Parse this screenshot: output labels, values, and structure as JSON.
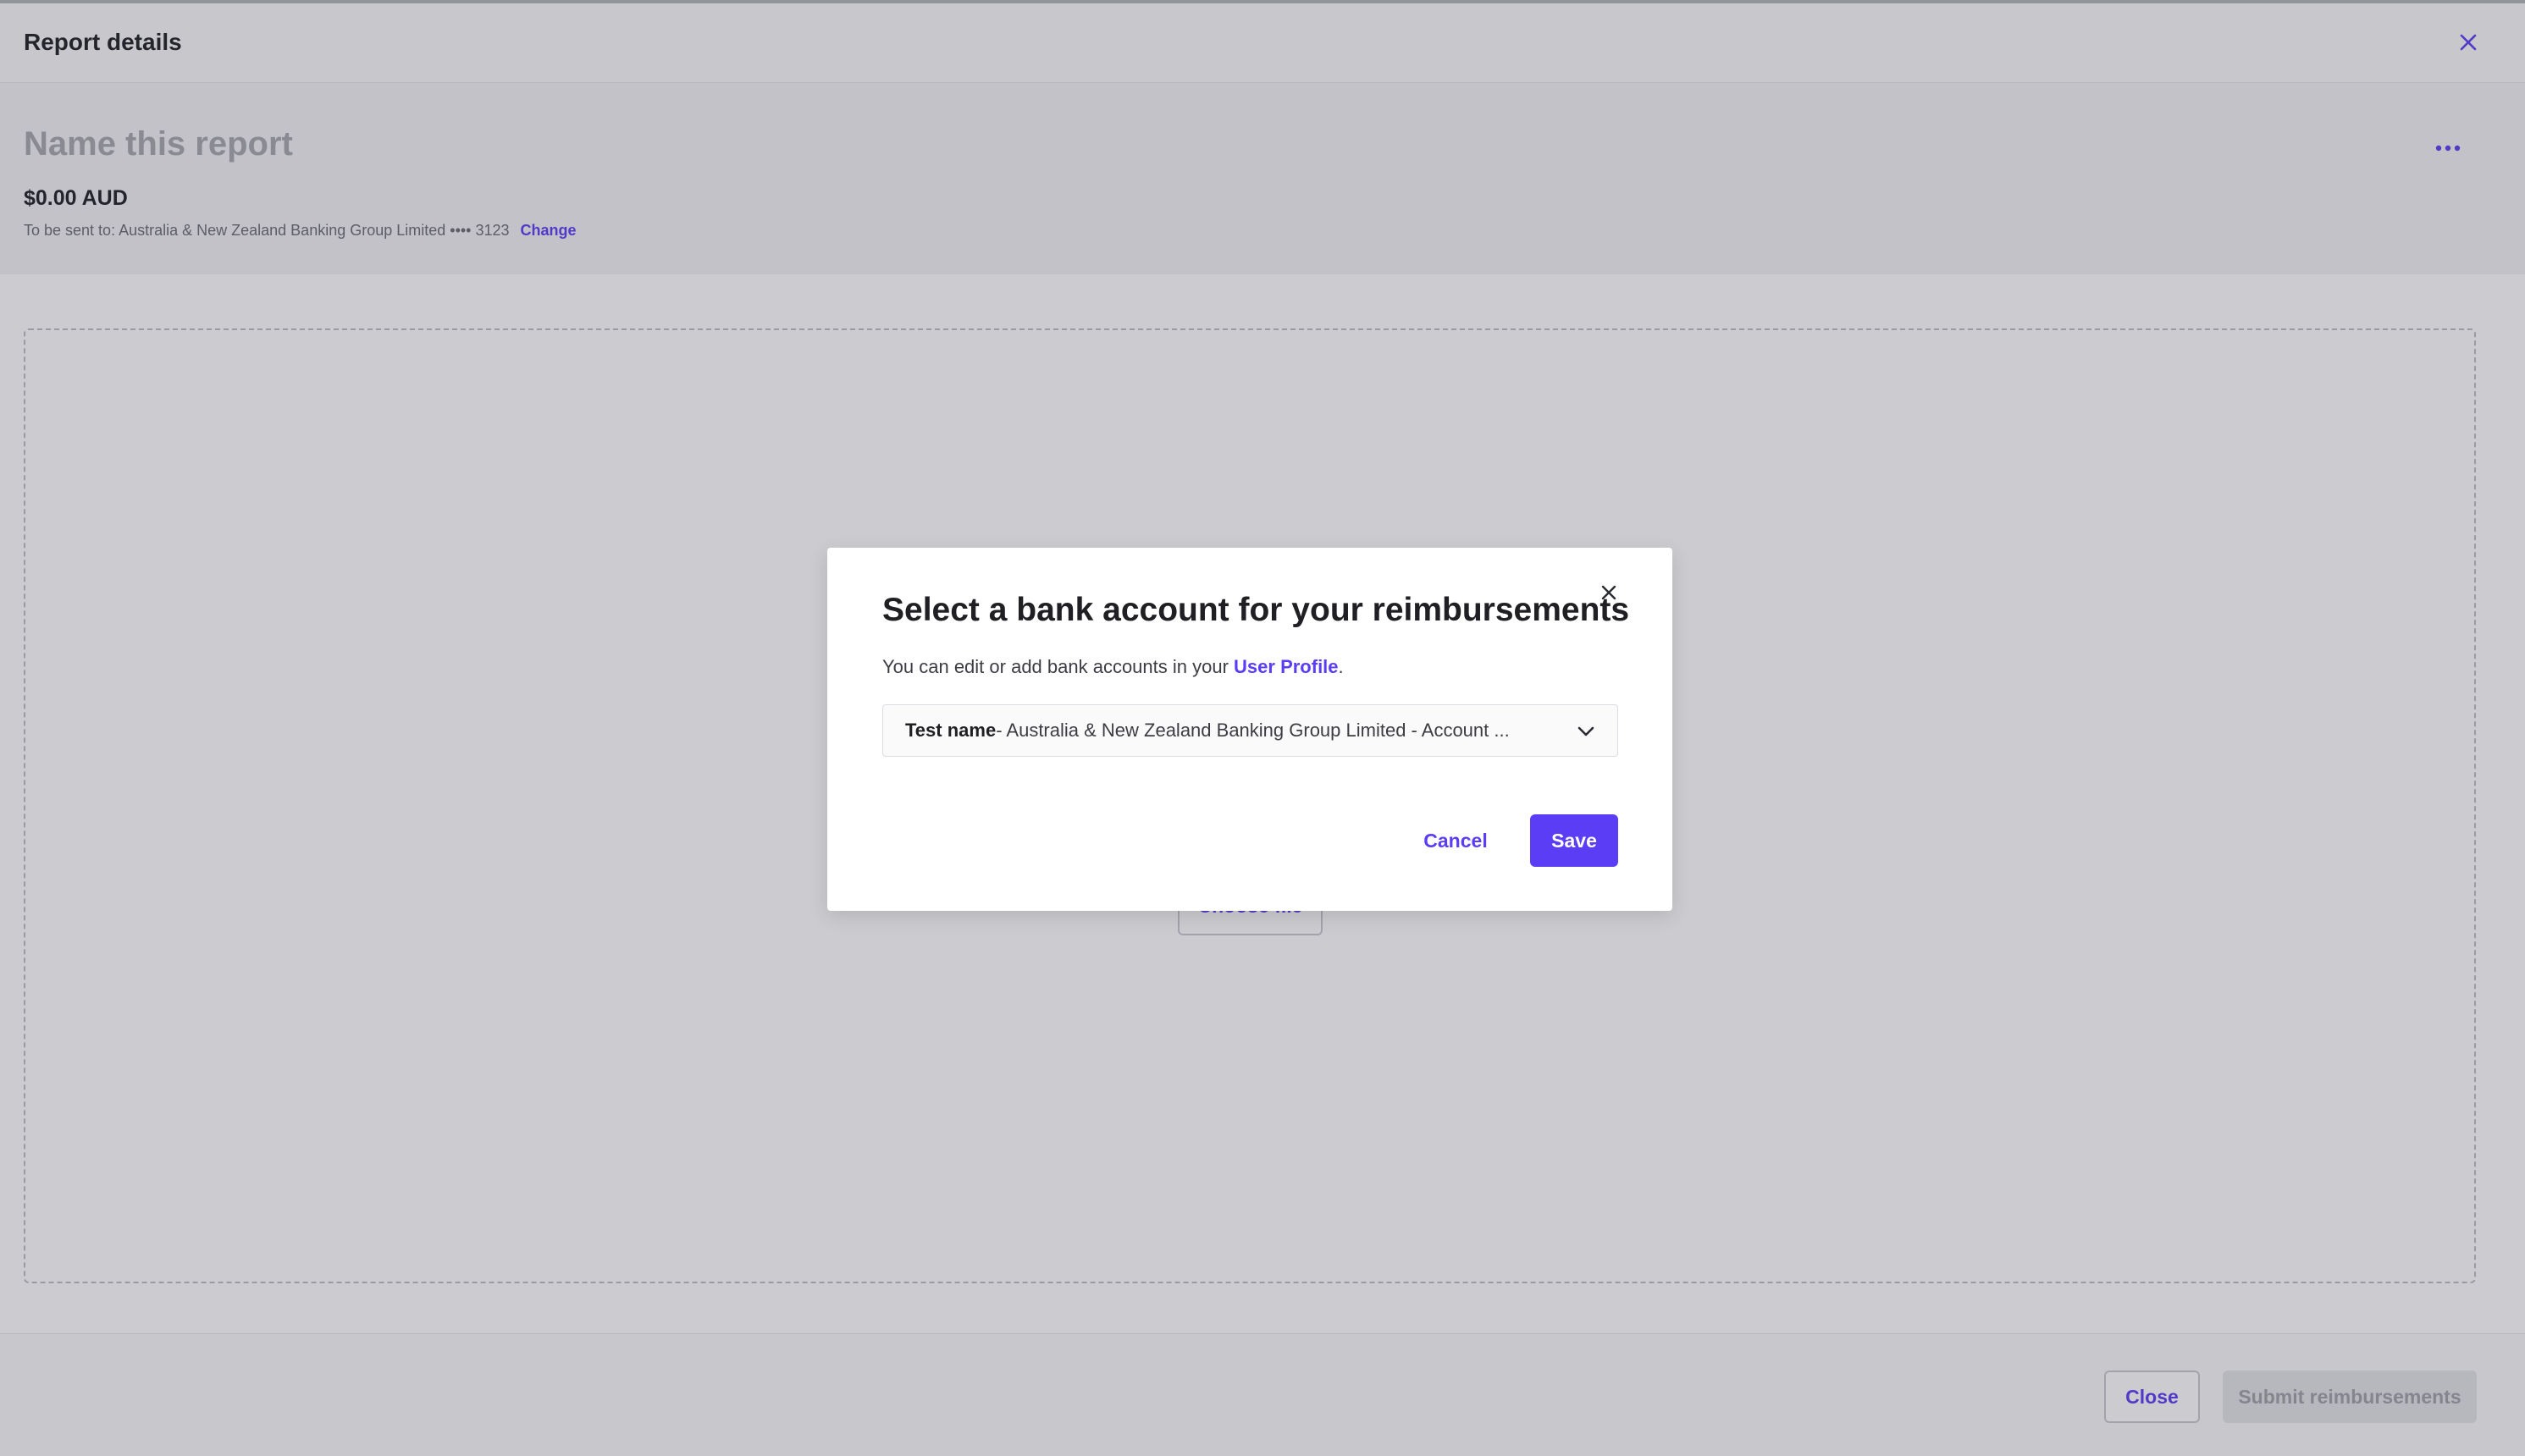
{
  "header": {
    "title": "Report details"
  },
  "report": {
    "name_placeholder": "Name this report",
    "amount": "$0.00 AUD",
    "send_to_label": "To be sent to: Australia & New Zealand Banking Group Limited •••• 3123",
    "change_link": "Change"
  },
  "dropzone": {
    "choose_file_label": "Choose file"
  },
  "footer": {
    "close_label": "Close",
    "submit_label": "Submit reimbursements"
  },
  "modal": {
    "title": "Select a bank account for your reimbursements",
    "description_prefix": "You can edit or add bank accounts in your ",
    "profile_link": "User Profile",
    "description_suffix": ".",
    "select": {
      "selected_name": "Test name",
      "selected_detail": " - Australia & New Zealand Banking Group Limited - Account ..."
    },
    "cancel_label": "Cancel",
    "save_label": "Save"
  },
  "icons": {
    "header_close": "close-icon",
    "more": "more-horizontal-icon",
    "modal_close": "close-icon",
    "select_chevron": "chevron-down-icon"
  },
  "colors": {
    "accent": "#5b3df5",
    "overlay": "rgba(52,52,66,0.25)"
  }
}
